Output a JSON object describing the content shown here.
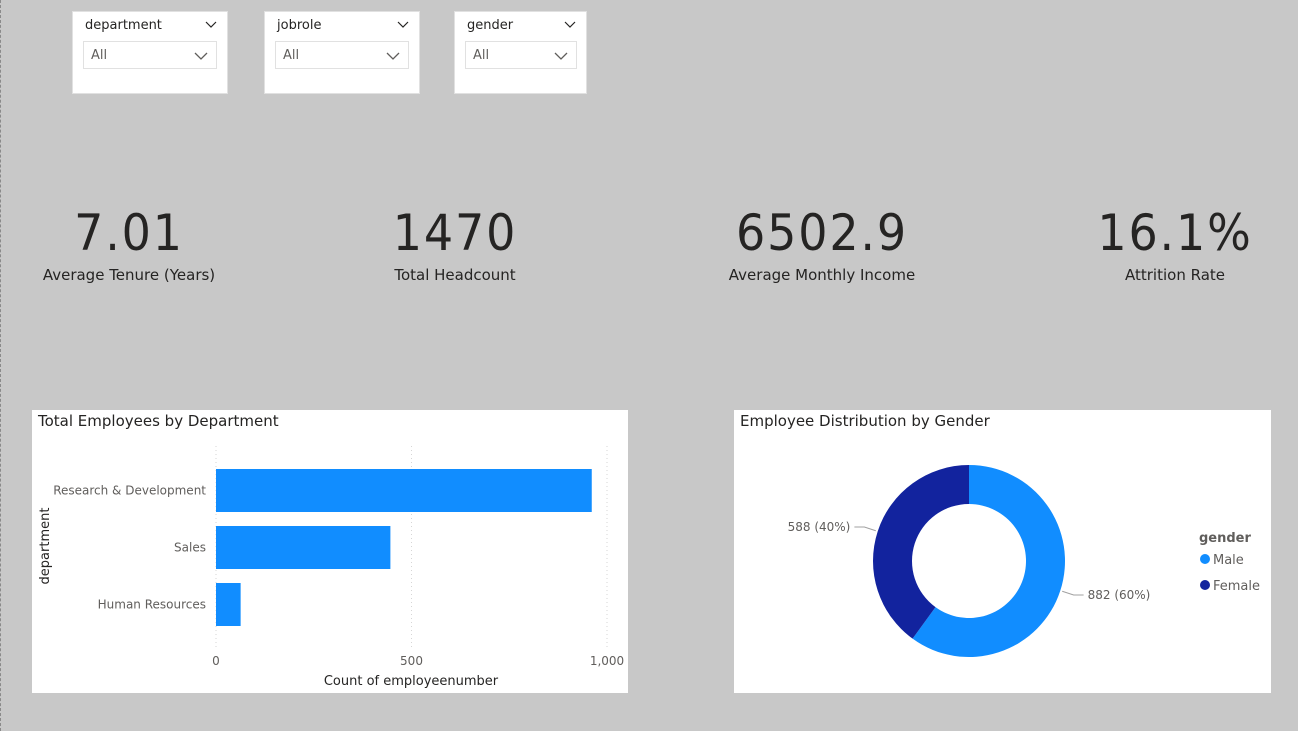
{
  "slicers": [
    {
      "title": "department",
      "selected": "All"
    },
    {
      "title": "jobrole",
      "selected": "All"
    },
    {
      "title": "gender",
      "selected": "All"
    }
  ],
  "kpis": [
    {
      "value": "7.01",
      "label": "Average Tenure (Years)"
    },
    {
      "value": "1470",
      "label": "Total Headcount"
    },
    {
      "value": "6502.9",
      "label": "Average Monthly Income"
    },
    {
      "value": "16.1%",
      "label": "Attrition Rate"
    }
  ],
  "colors": {
    "accent": "#118dff",
    "dark": "#12239e",
    "background": "#c8c8c8"
  },
  "chart_data": [
    {
      "type": "bar",
      "orientation": "horizontal",
      "title": "Total Employees by Department",
      "xlabel": "Count of employeenumber",
      "ylabel": "department",
      "categories": [
        "Research & Development",
        "Sales",
        "Human Resources"
      ],
      "values": [
        961,
        446,
        63
      ],
      "xlim": [
        0,
        1000
      ],
      "xticks": [
        "0",
        "500",
        "1,000"
      ],
      "grid": true,
      "color": "#118dff"
    },
    {
      "type": "pie",
      "donut": true,
      "title": "Employee Distribution by Gender",
      "legend_title": "gender",
      "legend_position": "right",
      "categories": [
        "Male",
        "Female"
      ],
      "values": [
        882,
        588
      ],
      "data_labels": [
        "882 (60%)",
        "588 (40%)"
      ],
      "colors": [
        "#118dff",
        "#12239e"
      ]
    }
  ]
}
